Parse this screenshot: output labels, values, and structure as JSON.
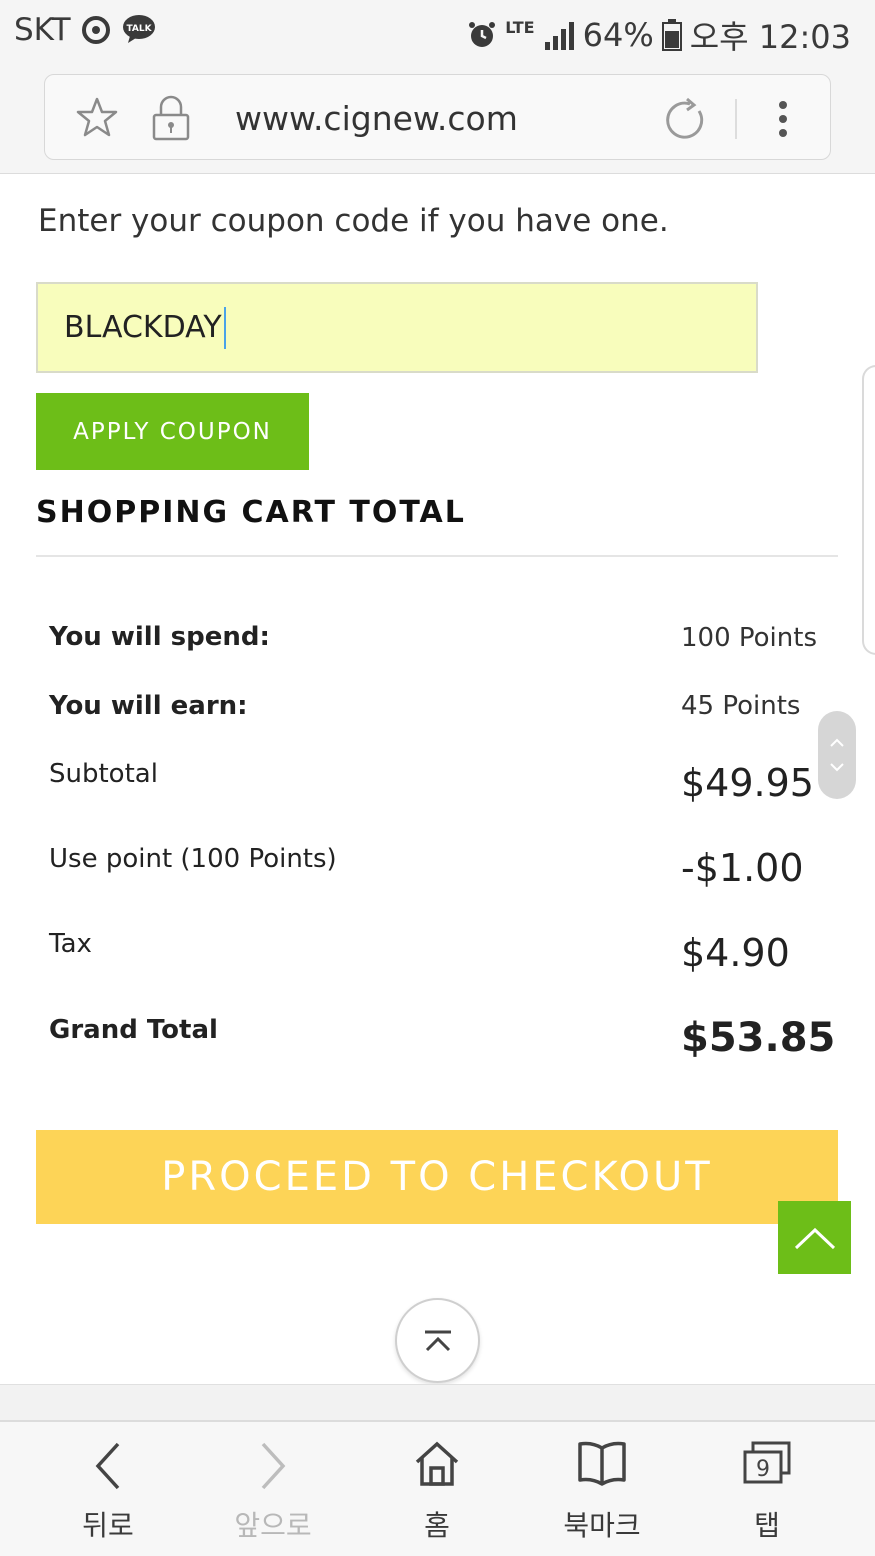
{
  "status_bar": {
    "carrier": "SKT",
    "talk_badge": "TALK",
    "network": "LTE",
    "battery": "64%",
    "time": "오후 12:03"
  },
  "browser": {
    "url": "www.cignew.com"
  },
  "coupon": {
    "prompt": "Enter your coupon code if you have one.",
    "value": "BLACKDAY",
    "apply_label": "APPLY COUPON"
  },
  "cart": {
    "title": "SHOPPING CART TOTAL",
    "rows": [
      {
        "label": "You will spend:",
        "value": "100 Points"
      },
      {
        "label": "You will earn:",
        "value": "45 Points"
      },
      {
        "label": "Subtotal",
        "value": "$49.95"
      },
      {
        "label": "Use point (100 Points)",
        "value": "-$1.00"
      },
      {
        "label": "Tax",
        "value": "$4.90"
      },
      {
        "label": "Grand Total",
        "value": "$53.85"
      }
    ],
    "checkout_label": "PROCEED TO CHECKOUT"
  },
  "bottom_nav": {
    "items": [
      {
        "label": "뒤로",
        "icon": "back-icon"
      },
      {
        "label": "앞으로",
        "icon": "forward-icon"
      },
      {
        "label": "홈",
        "icon": "home-icon"
      },
      {
        "label": "북마크",
        "icon": "bookmark-icon"
      },
      {
        "label": "탭",
        "icon": "tabs-icon"
      }
    ],
    "tab_count": "9"
  },
  "colors": {
    "accent_green": "#6dbe18",
    "checkout_yellow": "#fdd457",
    "coupon_field": "#f8fdbc"
  }
}
